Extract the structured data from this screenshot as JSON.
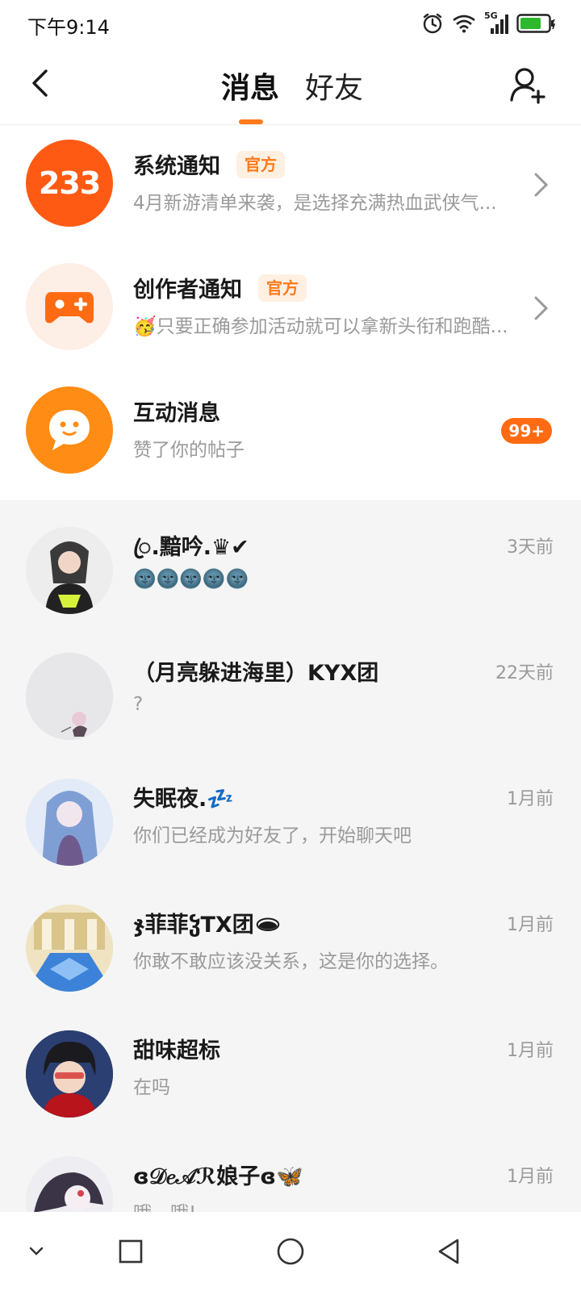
{
  "status": {
    "time": "下午9:14",
    "network": "5G",
    "icons": [
      "alarm-icon",
      "wifi-icon",
      "signal-icon",
      "battery-icon"
    ],
    "battery_color": "#2db82d"
  },
  "header": {
    "tabs": [
      {
        "label": "消息",
        "active": true
      },
      {
        "label": "好友",
        "active": false
      }
    ],
    "accent": "#ff7a1a"
  },
  "official": [
    {
      "title": "系统通知",
      "badge": "官方",
      "preview": "4月新游清单来袭，是选择充满热血武侠气...",
      "avatar_text": "233",
      "avatar_color": "#ff5a14"
    },
    {
      "title": "创作者通知",
      "badge": "官方",
      "preview": "🥳只要正确参加活动就可以拿新头衔和跑酷...",
      "avatar_color": "#fdeee6"
    },
    {
      "title": "互动消息",
      "preview": "赞了你的帖子",
      "count": "99+",
      "avatar_color": "#ff8c14"
    }
  ],
  "chats": [
    {
      "name": "ꦿ.黯吟.♛✔",
      "preview": "🌚🌚🌚🌚🌚",
      "time": "3天前"
    },
    {
      "name": "（月亮躲进海里）KYX团",
      "preview": "?",
      "time": "22天前"
    },
    {
      "name": "失眠夜.💤",
      "preview": "你们已经成为好友了，开始聊天吧",
      "time": "1月前"
    },
    {
      "name": "ჯ菲菲ჴTX团🕳",
      "preview": "你敢不敢应该没关系，这是你的选择。",
      "time": "1月前"
    },
    {
      "name": "甜味超标",
      "preview": "在吗",
      "time": "1月前"
    },
    {
      "name": "ɞ𝒟𝑒𝒜ℛ娘子ɞ🦋",
      "preview": "哦，哦!",
      "time": "1月前"
    }
  ],
  "navbar": {
    "icons": [
      "collapse-icon",
      "recents-icon",
      "home-icon",
      "back-triangle-icon"
    ]
  }
}
